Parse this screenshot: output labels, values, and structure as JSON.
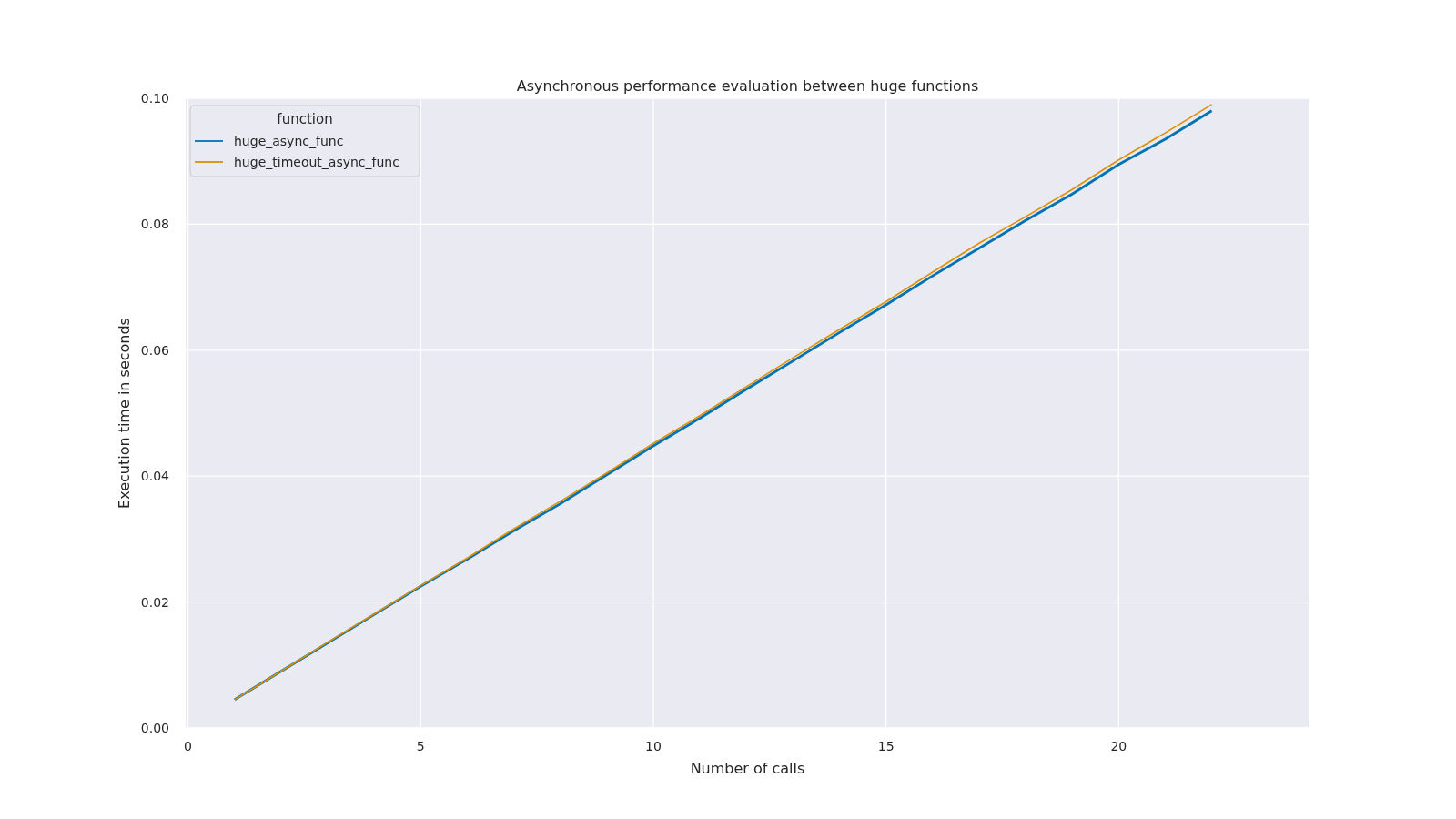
{
  "chart_data": {
    "type": "line",
    "title": "Asynchronous performance evaluation between huge functions",
    "xlabel": "Number of calls",
    "ylabel": "Execution time in seconds",
    "x": [
      1,
      2,
      3,
      4,
      5,
      6,
      7,
      8,
      9,
      10,
      11,
      12,
      13,
      14,
      15,
      16,
      17,
      18,
      19,
      20,
      21,
      22
    ],
    "series": [
      {
        "name": "huge_async_func",
        "color": "#0173b2",
        "values": [
          0.0045,
          0.009,
          0.0135,
          0.018,
          0.0225,
          0.0268,
          0.0313,
          0.0356,
          0.0402,
          0.0448,
          0.0492,
          0.0538,
          0.0583,
          0.0628,
          0.0672,
          0.0718,
          0.0762,
          0.0806,
          0.0848,
          0.0895,
          0.0935,
          0.098
        ]
      },
      {
        "name": "huge_timeout_async_func",
        "color": "#de8f05",
        "values": [
          0.0045,
          0.009,
          0.0136,
          0.0181,
          0.0226,
          0.027,
          0.0316,
          0.036,
          0.0405,
          0.0452,
          0.0496,
          0.0542,
          0.0588,
          0.0633,
          0.0677,
          0.0724,
          0.077,
          0.0812,
          0.0855,
          0.0902,
          0.0945,
          0.099
        ]
      }
    ],
    "xlim": [
      -0.05,
      24.1
    ],
    "ylim": [
      0,
      0.1
    ],
    "xticks": [
      0,
      5,
      10,
      15,
      20
    ],
    "yticks": [
      {
        "value": 0,
        "label": "0.00"
      },
      {
        "value": 0.02,
        "label": "0.02"
      },
      {
        "value": 0.04,
        "label": "0.04"
      },
      {
        "value": 0.06,
        "label": "0.06"
      },
      {
        "value": 0.08,
        "label": "0.08"
      },
      {
        "value": 0.1,
        "label": "0.10"
      }
    ],
    "grid": true,
    "legend": {
      "title": "function"
    }
  }
}
